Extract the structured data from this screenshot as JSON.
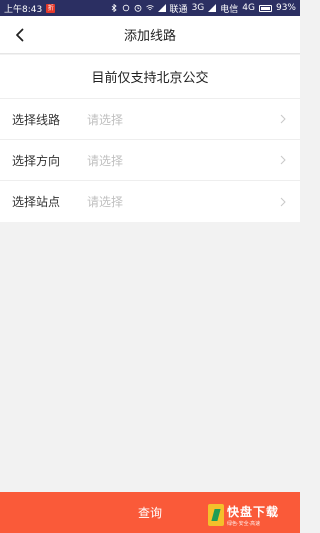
{
  "status_bar": {
    "time": "上午8:43",
    "notification_badge": "折",
    "carrier1": "联通",
    "network1": "3G",
    "carrier2": "电信",
    "network2": "4G",
    "battery": "93%"
  },
  "navbar": {
    "title": "添加线路",
    "back_icon": "chevron-left-icon"
  },
  "notice": "目前仅支持北京公交",
  "form": {
    "rows": [
      {
        "label": "选择线路",
        "placeholder": "请选择"
      },
      {
        "label": "选择方向",
        "placeholder": "请选择"
      },
      {
        "label": "选择站点",
        "placeholder": "请选择"
      }
    ]
  },
  "query_button": {
    "label": "查询",
    "color": "#fa5a39"
  },
  "watermark": {
    "main": "快盘下载",
    "sub": "绿色·安全·高速"
  }
}
